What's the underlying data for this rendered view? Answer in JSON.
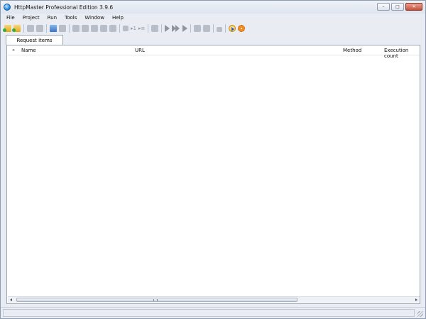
{
  "window": {
    "title": "HttpMaster Professional Edition 3.9.6",
    "controls": {
      "minimize": "–",
      "maximize": "□",
      "close": "✕"
    }
  },
  "menu": [
    "File",
    "Project",
    "Run",
    "Tools",
    "Window",
    "Help"
  ],
  "toolbar": {
    "icons": [
      "open-project-icon",
      "save-project-icon",
      "copy-icon",
      "paste-icon",
      "add-request-icon",
      "delete-request-icon",
      "move-up-icon",
      "move-down-icon",
      "edit-icon",
      "clone-icon",
      "list-icon",
      "run-one-icon",
      "run-selected-icon",
      "link-icon",
      "execute-icon",
      "execute-all-icon",
      "execute-step-icon",
      "refresh-icon",
      "export-icon",
      "lock-icon",
      "run-circle-icon",
      "settings-gear-icon"
    ],
    "text_icons": {
      "run_one": "▸1",
      "run_list": "▸≡"
    }
  },
  "tabs": [
    {
      "label": "Request items"
    }
  ],
  "table": {
    "columns": {
      "name": "Name",
      "url": "URL",
      "method": "Method",
      "execution_count": "Execution count"
    },
    "rows": []
  },
  "scrollbar": {
    "grip": ""
  },
  "status": {
    "text": ""
  },
  "colors": {
    "window_bg": "#e9ecf2",
    "border": "#9aa6b6",
    "accent": "#f08a1a"
  }
}
